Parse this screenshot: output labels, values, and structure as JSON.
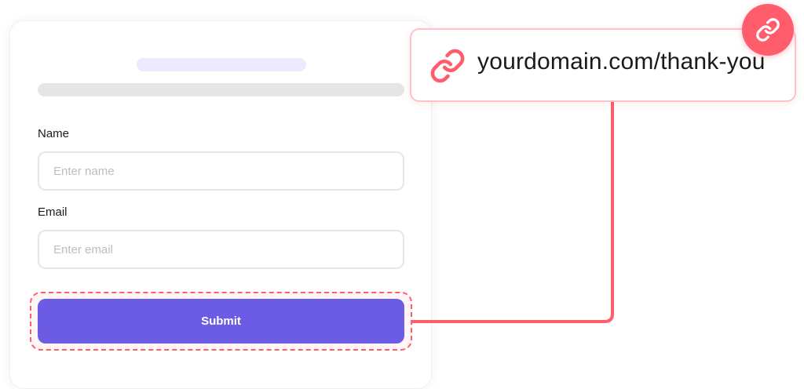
{
  "form": {
    "fields": [
      {
        "label": "Name",
        "placeholder": "Enter name"
      },
      {
        "label": "Email",
        "placeholder": "Enter email"
      }
    ],
    "submit_label": "Submit"
  },
  "redirect": {
    "url": "yourdomain.com/thank-you",
    "icon": "link-icon"
  },
  "colors": {
    "accent": "#6c5ce4",
    "link": "#ff5d6c",
    "skeleton": "#e6e6e6",
    "skeleton_title": "#eceafd"
  }
}
